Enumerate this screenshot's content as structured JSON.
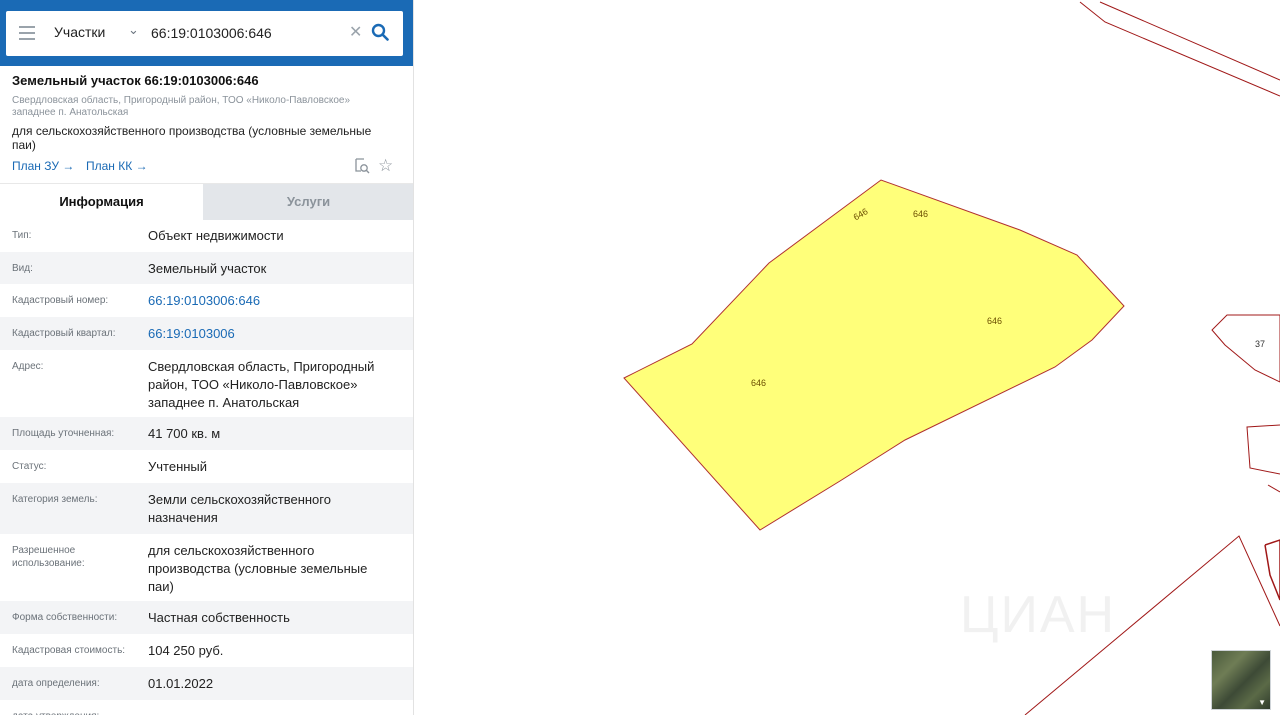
{
  "search": {
    "type_label": "Участки",
    "query": "66:19:0103006:646"
  },
  "parcel": {
    "title": "Земельный участок 66:19:0103006:646",
    "address": "Свердловская область, Пригородный район, ТОО «Николо-Павловское» западнее п. Анатольская",
    "use": "для сельскохозяйственного производства (условные земельные паи)",
    "links": {
      "plan_zu": "План ЗУ →",
      "plan_kk": "План КК →"
    }
  },
  "tabs": {
    "info": "Информация",
    "services": "Услуги"
  },
  "properties": [
    {
      "key": "Тип:",
      "value": "Объект недвижимости"
    },
    {
      "key": "Вид:",
      "value": "Земельный участок"
    },
    {
      "key": "Кадастровый номер:",
      "value": "66:19:0103006:646"
    },
    {
      "key": "Кадастровый квартал:",
      "value": "66:19:0103006"
    },
    {
      "key": "Адрес:",
      "value": "Свердловская область, Пригородный район, ТОО «Николо-Павловское» западнее п. Анатольская"
    },
    {
      "key": "Площадь уточненная:",
      "value": "41 700 кв. м"
    },
    {
      "key": "Статус:",
      "value": "Учтенный"
    },
    {
      "key": "Категория земель:",
      "value": "Земли сельскохозяйственного назначения"
    },
    {
      "key": "Разрешенное использование:",
      "value": "для сельскохозяйственного производства (условные земельные паи)"
    },
    {
      "key": "Форма собственности:",
      "value": "Частная собственность"
    },
    {
      "key": "Кадастровая стоимость:",
      "value": "104 250 руб."
    },
    {
      "key": "дата определения:",
      "value": "01.01.2022"
    },
    {
      "key": "дата утверждения:",
      "value": ""
    }
  ],
  "map": {
    "parcel_labels": [
      "646",
      "646",
      "646",
      "646"
    ],
    "neighbor_label": "37",
    "watermark": "ЦИАН",
    "colors": {
      "parcel_fill": "#ffff7a",
      "parcel_stroke": "#b03030",
      "boundary": "#a01818",
      "brand_blue": "#1a6ab5"
    }
  }
}
